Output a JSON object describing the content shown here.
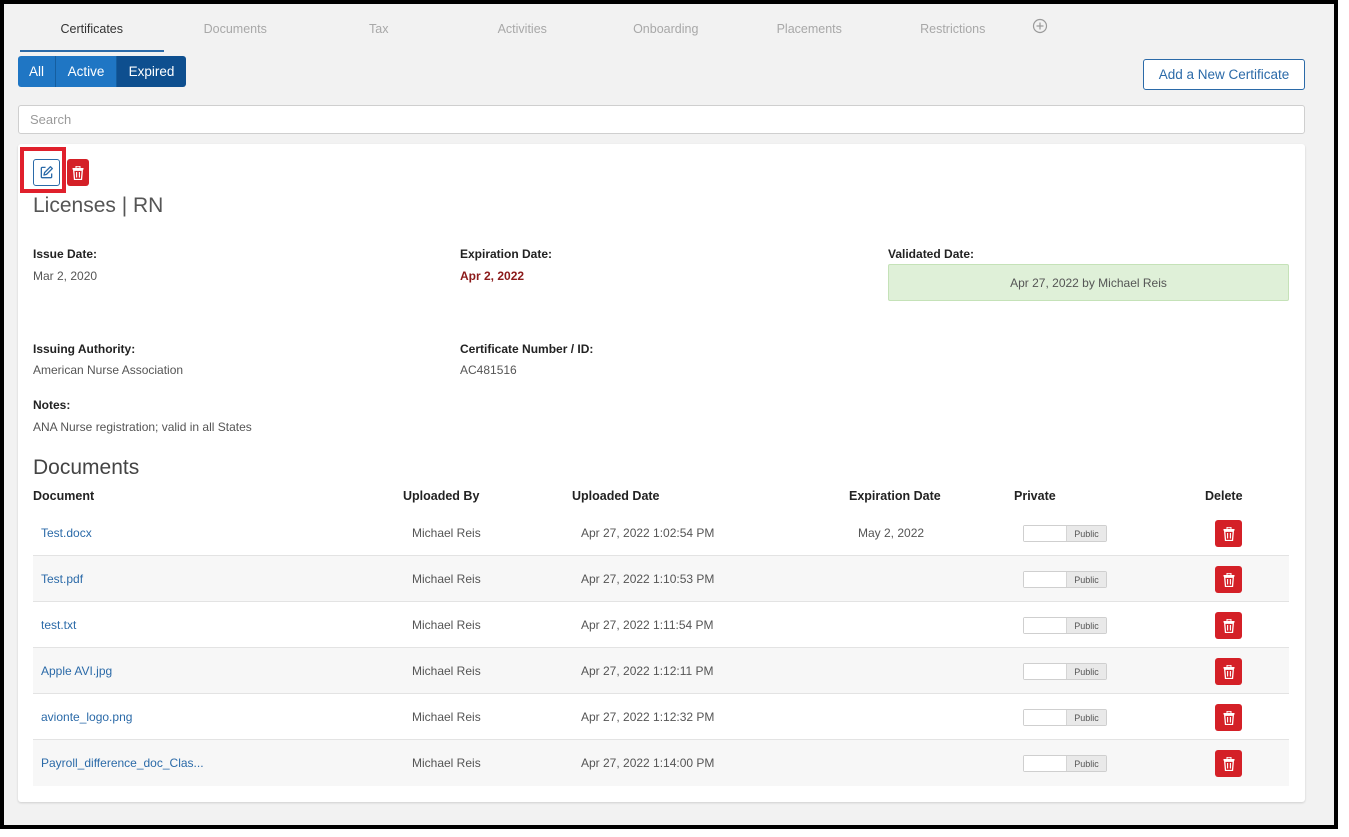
{
  "tabs": [
    {
      "label": "Certificates",
      "active": true
    },
    {
      "label": "Documents"
    },
    {
      "label": "Tax"
    },
    {
      "label": "Activities"
    },
    {
      "label": "Onboarding"
    },
    {
      "label": "Placements"
    },
    {
      "label": "Restrictions"
    }
  ],
  "tab_add_icon": "plus-circle-icon",
  "filters": {
    "all": "All",
    "active": "Active",
    "expired": "Expired",
    "selected": "Expired"
  },
  "add_certificate_label": "Add a New Certificate",
  "search": {
    "placeholder": "Search",
    "value": ""
  },
  "certificate": {
    "title": "Licenses | RN",
    "issue_date_label": "Issue Date:",
    "issue_date": "Mar 2, 2020",
    "expiration_date_label": "Expiration Date:",
    "expiration_date": "Apr 2, 2022",
    "validated_date_label": "Validated Date:",
    "validated_date": "Apr 27, 2022 by Michael Reis",
    "issuing_authority_label": "Issuing Authority:",
    "issuing_authority": "American Nurse Association",
    "cert_number_label": "Certificate Number / ID:",
    "cert_number": "AC481516",
    "notes_label": "Notes:",
    "notes": "ANA Nurse registration; valid in all States"
  },
  "documents": {
    "title": "Documents",
    "columns": [
      "Document",
      "Uploaded By",
      "Uploaded Date",
      "Expiration Date",
      "Private",
      "Delete"
    ],
    "rows": [
      {
        "name": "Test.docx",
        "uploaded_by": "Michael Reis",
        "uploaded_date": "Apr 27, 2022 1:02:54 PM",
        "expiration": "May 2, 2022",
        "private": "Public"
      },
      {
        "name": "Test.pdf",
        "uploaded_by": "Michael Reis",
        "uploaded_date": "Apr 27, 2022 1:10:53 PM",
        "expiration": "",
        "private": "Public"
      },
      {
        "name": "test.txt",
        "uploaded_by": "Michael Reis",
        "uploaded_date": "Apr 27, 2022 1:11:54 PM",
        "expiration": "",
        "private": "Public"
      },
      {
        "name": "Apple AVI.jpg",
        "uploaded_by": "Michael Reis",
        "uploaded_date": "Apr 27, 2022 1:12:11 PM",
        "expiration": "",
        "private": "Public"
      },
      {
        "name": "avionte_logo.png",
        "uploaded_by": "Michael Reis",
        "uploaded_date": "Apr 27, 2022 1:12:32 PM",
        "expiration": "",
        "private": "Public"
      },
      {
        "name": "Payroll_difference_doc_Clas...",
        "uploaded_by": "Michael Reis",
        "uploaded_date": "Apr 27, 2022 1:14:00 PM",
        "expiration": "",
        "private": "Public"
      }
    ]
  },
  "colors": {
    "primary": "#1f76c4",
    "danger": "#d42027",
    "highlight": "#e0202c",
    "validated_bg": "#dff0d8"
  }
}
